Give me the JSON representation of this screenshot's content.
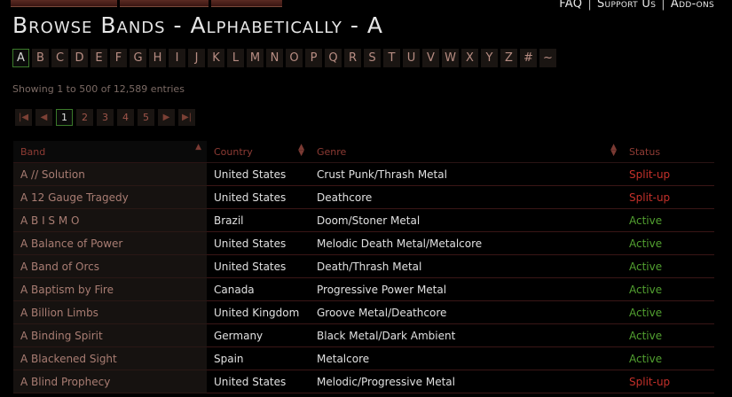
{
  "header": {
    "links": [
      "FAQ",
      "Support Us",
      "Add-ons"
    ],
    "title": "Browse Bands - Alphabetically - A"
  },
  "letters": [
    "A",
    "B",
    "C",
    "D",
    "E",
    "F",
    "G",
    "H",
    "I",
    "J",
    "K",
    "L",
    "M",
    "N",
    "O",
    "P",
    "Q",
    "R",
    "S",
    "T",
    "U",
    "V",
    "W",
    "X",
    "Y",
    "Z",
    "#",
    "~"
  ],
  "active_letter": "A",
  "info_text": "Showing 1 to 500 of 12,589 entries",
  "pagination": {
    "first_icon": "first-page-icon",
    "prev_icon": "prev-page-icon",
    "pages": [
      "1",
      "2",
      "3",
      "4",
      "5"
    ],
    "active_page": "1",
    "next_icon": "next-page-icon",
    "last_icon": "last-page-icon"
  },
  "table": {
    "headers": [
      "Band",
      "Country",
      "Genre",
      "Status"
    ],
    "rows": [
      {
        "band": "A // Solution",
        "country": "United States",
        "genre": "Crust Punk/Thrash Metal",
        "status": "Split-up"
      },
      {
        "band": "A 12 Gauge Tragedy",
        "country": "United States",
        "genre": "Deathcore",
        "status": "Split-up"
      },
      {
        "band": "A B I S M O",
        "country": "Brazil",
        "genre": "Doom/Stoner Metal",
        "status": "Active"
      },
      {
        "band": "A Balance of Power",
        "country": "United States",
        "genre": "Melodic Death Metal/Metalcore",
        "status": "Active"
      },
      {
        "band": "A Band of Orcs",
        "country": "United States",
        "genre": "Death/Thrash Metal",
        "status": "Active"
      },
      {
        "band": "A Baptism by Fire",
        "country": "Canada",
        "genre": "Progressive Power Metal",
        "status": "Active"
      },
      {
        "band": "A Billion Limbs",
        "country": "United Kingdom",
        "genre": "Groove Metal/Deathcore",
        "status": "Active"
      },
      {
        "band": "A Binding Spirit",
        "country": "Germany",
        "genre": "Black Metal/Dark Ambient",
        "status": "Active"
      },
      {
        "band": "A Blackened Sight",
        "country": "Spain",
        "genre": "Metalcore",
        "status": "Active"
      },
      {
        "band": "A Blind Prophecy",
        "country": "United States",
        "genre": "Melodic/Progressive Metal",
        "status": "Split-up"
      }
    ]
  },
  "colors": {
    "status_active": "#52a030",
    "status_split": "#c4302a",
    "link": "#a97d73"
  }
}
